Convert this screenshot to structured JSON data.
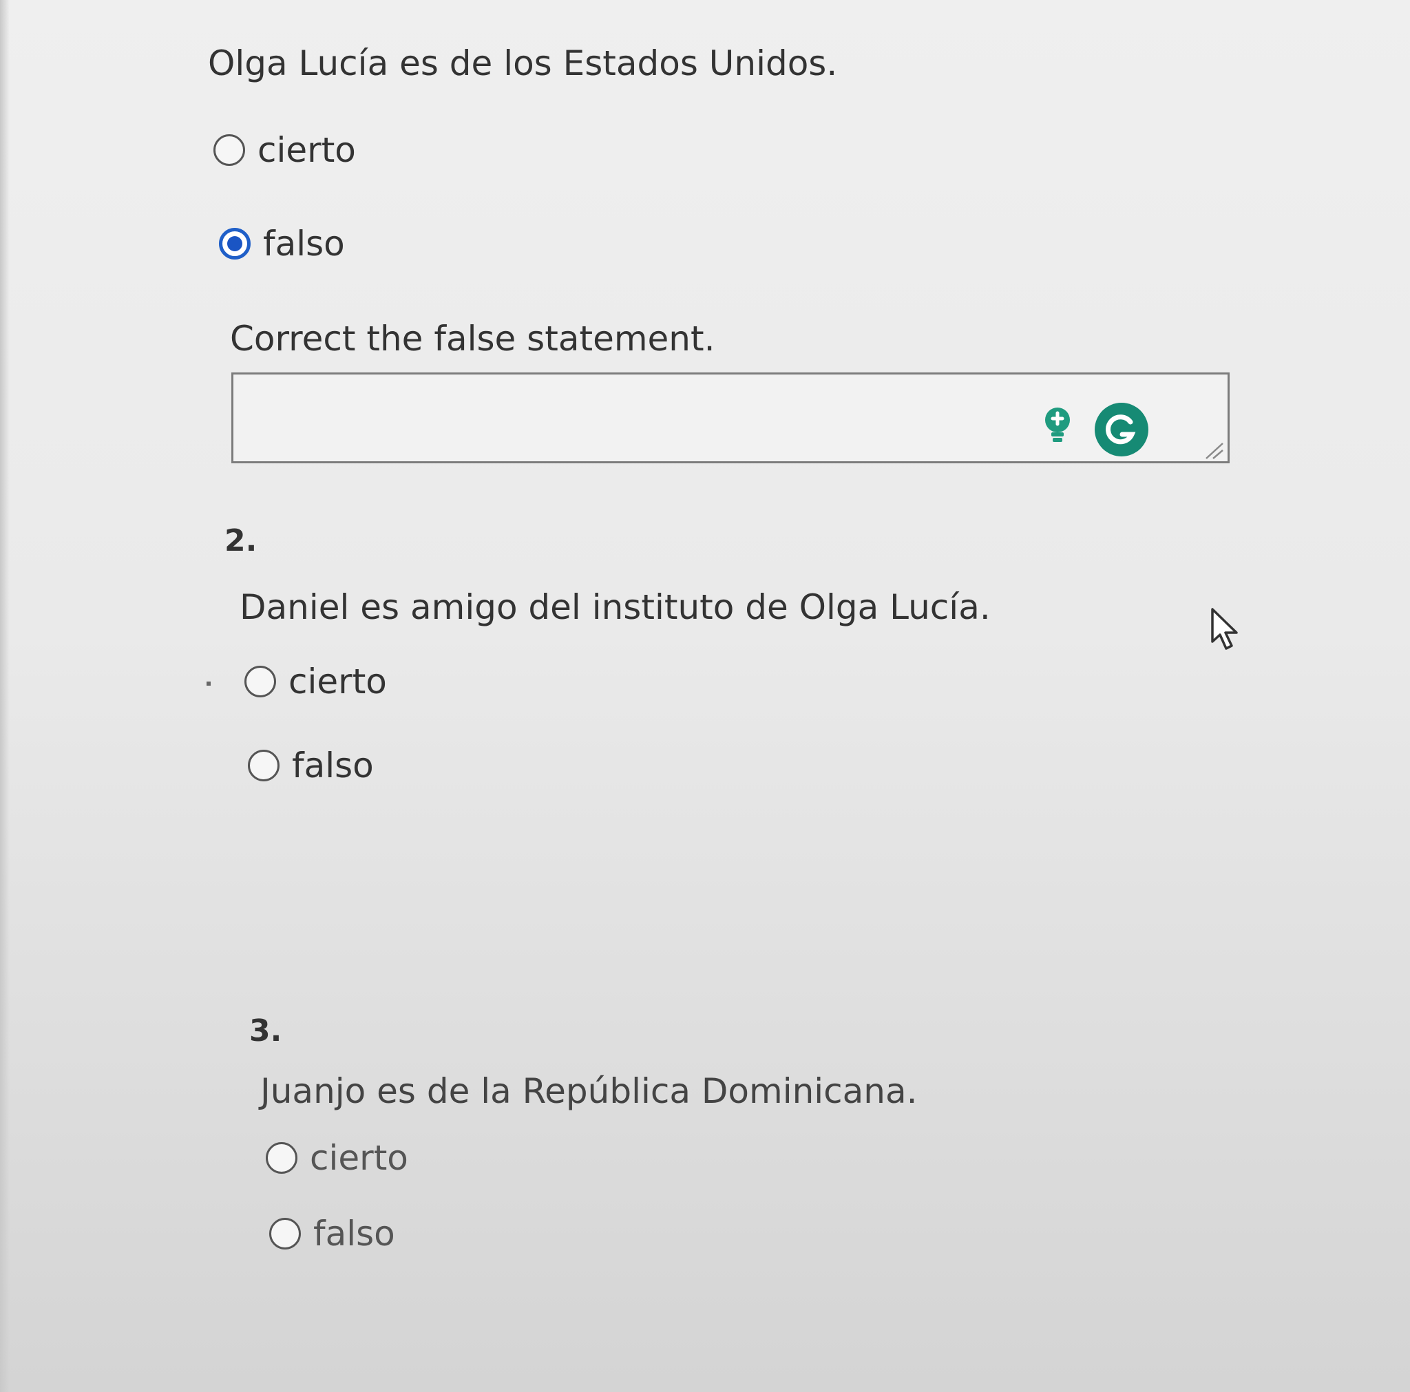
{
  "question1": {
    "text": "Olga Lucía es de los Estados Unidos.",
    "options": [
      {
        "label": "cierto",
        "selected": false
      },
      {
        "label": "falso",
        "selected": true
      }
    ],
    "correction_prompt": "Correct the false statement.",
    "correction_value": ""
  },
  "question2": {
    "number": "2.",
    "text": "Daniel es amigo del instituto de Olga Lucía.",
    "options": [
      {
        "label": "cierto",
        "selected": false
      },
      {
        "label": "falso",
        "selected": false
      }
    ]
  },
  "question3": {
    "number": "3.",
    "text": "Juanjo es de la República Dominicana.",
    "options": [
      {
        "label": "cierto",
        "selected": false
      },
      {
        "label": "falso",
        "selected": false
      }
    ]
  },
  "icons": {
    "hint": "lightbulb-icon",
    "grammarly": "grammarly-icon",
    "resize": "resize-handle-icon",
    "cursor": "mouse-pointer-icon"
  },
  "colors": {
    "radio_selected": "#1a55c4",
    "grammarly_green": "#168a74",
    "hint_green": "#1f9b7f"
  }
}
